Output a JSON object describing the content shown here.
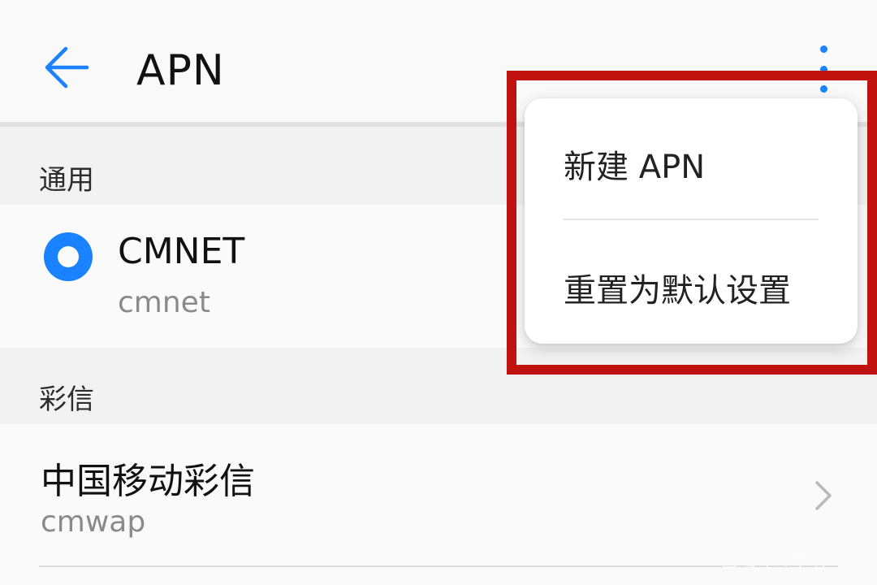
{
  "appbar": {
    "title": "APN",
    "back_icon": "arrow-left-icon",
    "overflow_icon": "more-vertical-icon"
  },
  "sections": [
    {
      "header": "通用",
      "items": [
        {
          "name": "CMNET",
          "apn": "cmnet",
          "selected": true
        }
      ]
    },
    {
      "header": "彩信",
      "items": [
        {
          "name": "中国移动彩信",
          "apn": "cmwap",
          "icon": "chevron-right-icon"
        }
      ]
    }
  ],
  "menu": {
    "items": [
      {
        "label": "新建 APN"
      },
      {
        "label": "重置为默认设置"
      }
    ]
  },
  "watermark": "百家号·工作",
  "colors": {
    "accent": "#1a82ff",
    "highlight_frame": "#c0130f",
    "background": "#f2f2f2",
    "row_background": "#fafafa",
    "secondary_text": "#8a8a8a"
  }
}
